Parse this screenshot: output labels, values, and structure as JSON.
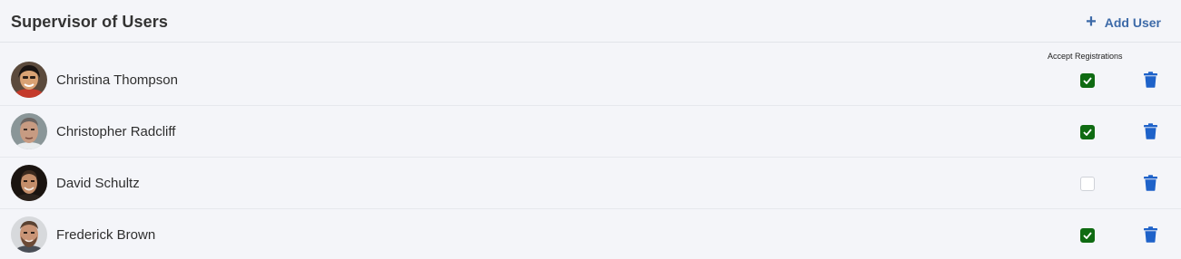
{
  "header": {
    "title": "Supervisor of Users",
    "add_user_icon": "plus-icon",
    "add_user_label": "Add User"
  },
  "columns": {
    "accept_registrations": "Accept Registrations"
  },
  "colors": {
    "accent": "#3d6aa8",
    "checked": "#0f6b12",
    "trash": "#1e62c9"
  },
  "users": [
    {
      "name": "Christina Thompson",
      "avatar": "user-photo",
      "accept_registrations": true
    },
    {
      "name": "Christopher Radcliff",
      "avatar": "user-photo",
      "accept_registrations": true
    },
    {
      "name": "David Schultz",
      "avatar": "user-photo",
      "accept_registrations": false
    },
    {
      "name": "Frederick Brown",
      "avatar": "user-photo",
      "accept_registrations": true
    }
  ]
}
